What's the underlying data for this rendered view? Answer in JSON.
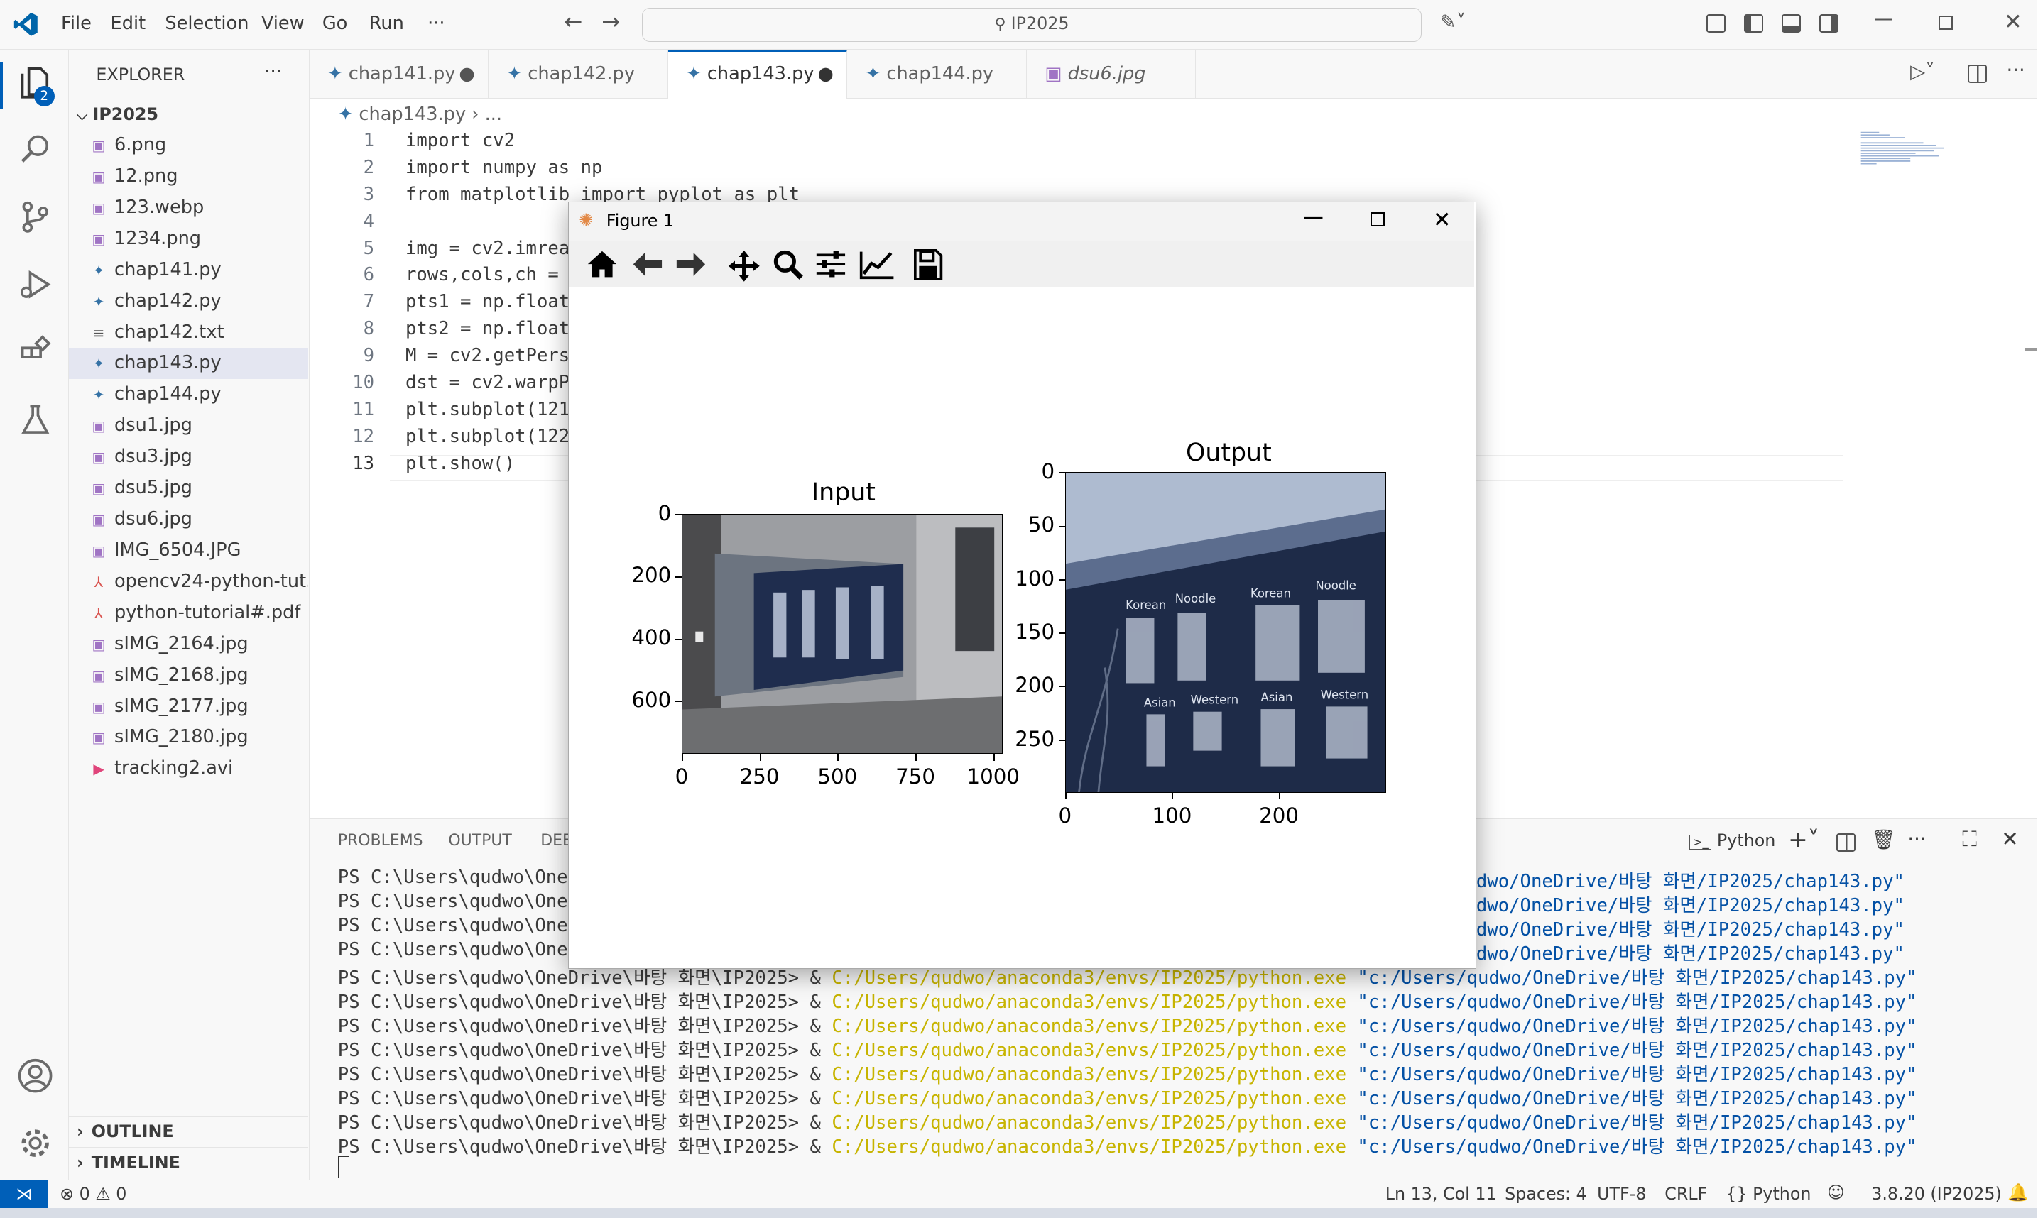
{
  "titlebar": {
    "menus": [
      "File",
      "Edit",
      "Selection",
      "View",
      "Go",
      "Run",
      "···"
    ],
    "search": "IP2025"
  },
  "activity": {
    "badge": "2"
  },
  "explorer": {
    "title": "EXPLORER",
    "more": "···",
    "folder": "IP2025",
    "files": [
      {
        "name": "6.png",
        "type": "image"
      },
      {
        "name": "12.png",
        "type": "image"
      },
      {
        "name": "123.webp",
        "type": "image"
      },
      {
        "name": "1234.png",
        "type": "image"
      },
      {
        "name": "chap141.py",
        "type": "python"
      },
      {
        "name": "chap142.py",
        "type": "python"
      },
      {
        "name": "chap142.txt",
        "type": "text"
      },
      {
        "name": "chap143.py",
        "type": "python"
      },
      {
        "name": "chap144.py",
        "type": "python"
      },
      {
        "name": "dsu1.jpg",
        "type": "image"
      },
      {
        "name": "dsu3.jpg",
        "type": "image"
      },
      {
        "name": "dsu5.jpg",
        "type": "image"
      },
      {
        "name": "dsu6.jpg",
        "type": "image"
      },
      {
        "name": "IMG_6504.JPG",
        "type": "image"
      },
      {
        "name": "opencv24-python-tut...",
        "type": "pdf"
      },
      {
        "name": "python-tutorial#.pdf",
        "type": "pdf"
      },
      {
        "name": "sIMG_2164.jpg",
        "type": "image"
      },
      {
        "name": "sIMG_2168.jpg",
        "type": "image"
      },
      {
        "name": "sIMG_2177.jpg",
        "type": "image"
      },
      {
        "name": "sIMG_2180.jpg",
        "type": "image"
      },
      {
        "name": "tracking2.avi",
        "type": "video"
      }
    ],
    "outline": "OUTLINE",
    "timeline": "TIMELINE"
  },
  "tabs": [
    {
      "label": "chap141.py",
      "dirty": "●"
    },
    {
      "label": "chap142.py",
      "dirty": ""
    },
    {
      "label": "chap143.py",
      "dirty": "●"
    },
    {
      "label": "chap144.py",
      "dirty": ""
    },
    {
      "label": "dsu6.jpg",
      "dirty": ""
    }
  ],
  "breadcrumb": {
    "file": "chap143.py",
    "rest": "..."
  },
  "code": {
    "lines": [
      {
        "n": "1",
        "t": "import cv2"
      },
      {
        "n": "2",
        "t": "import numpy as np"
      },
      {
        "n": "3",
        "t": "from matplotlib import pyplot as plt"
      },
      {
        "n": "4",
        "t": ""
      },
      {
        "n": "5",
        "t": "img = cv2.imrea"
      },
      {
        "n": "6",
        "t": "rows,cols,ch = "
      },
      {
        "n": "7",
        "t": "pts1 = np.float"
      },
      {
        "n": "8",
        "t": "pts2 = np.float"
      },
      {
        "n": "9",
        "t": "M = cv2.getPers"
      },
      {
        "n": "10",
        "t": "dst = cv2.warpP"
      },
      {
        "n": "11",
        "t": "plt.subplot(121"
      },
      {
        "n": "12",
        "t": "plt.subplot(122"
      },
      {
        "n": "13",
        "t": "plt.show()"
      }
    ]
  },
  "panel": {
    "tabs": [
      "PROBLEMS",
      "OUTPUT",
      "DEB"
    ],
    "shell": "Python",
    "short_lines": [
      "PS C:\\Users\\qudwo\\OneD",
      "PS C:\\Users\\qudwo\\OneD",
      "PS C:\\Users\\qudwo\\OneD",
      "PS C:\\Users\\qudwo\\OneD"
    ],
    "short_tails": [
      "dwo/OneDrive/바탕 화면/IP2025/chap143.py\"",
      "dwo/OneDrive/바탕 화면/IP2025/chap143.py\"",
      "dwo/OneDrive/바탕 화면/IP2025/chap143.py\"",
      "dwo/OneDrive/바탕 화면/IP2025/chap143.py\""
    ],
    "prompt": "PS C:\\Users\\qudwo\\OneDrive\\바탕 화면\\IP2025> & ",
    "exe": "C:/Users/qudwo/anaconda3/envs/IP2025/python.exe",
    "arg": " \"c:/Users/qudwo/OneDrive/바탕 화면/IP2025/chap143.py\"",
    "full_count": 8
  },
  "status": {
    "errors": "0",
    "warnings": "0",
    "position": "Ln 13, Col 11",
    "spaces": "Spaces: 4",
    "encoding": "UTF-8",
    "eol": "CRLF",
    "lang": "Python",
    "interpreter": "3.8.20 (IP2025)"
  },
  "figure": {
    "title": "Figure 1",
    "input": {
      "title": "Input",
      "xticks": [
        "0",
        "250",
        "500",
        "750",
        "1000"
      ],
      "yticks": [
        "0",
        "200",
        "400",
        "600"
      ]
    },
    "output": {
      "title": "Output",
      "xticks": [
        "0",
        "100",
        "200"
      ],
      "yticks": [
        "0",
        "50",
        "100",
        "150",
        "200",
        "250"
      ]
    },
    "sign_labels": [
      "Korean",
      "Noodle",
      "Asian",
      "Western"
    ]
  }
}
